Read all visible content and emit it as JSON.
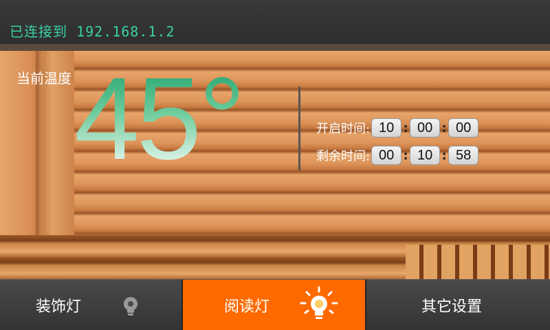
{
  "status": {
    "connection_text": "已连接到 192.168.1.2"
  },
  "temperature": {
    "label": "当前温度",
    "value": "45°"
  },
  "timers": {
    "start": {
      "label": "开启时间:",
      "hours": "10",
      "minutes": "00",
      "seconds": "00"
    },
    "remaining": {
      "label": "剩余时间:",
      "hours": "00",
      "minutes": "10",
      "seconds": "58"
    },
    "separator": ":"
  },
  "nav": {
    "items": [
      {
        "label": "装饰灯",
        "icon": "bulb-icon",
        "active": false
      },
      {
        "label": "阅读灯",
        "icon": "bulb-glow-icon",
        "active": true
      },
      {
        "label": "其它设置",
        "active": false
      }
    ]
  },
  "colors": {
    "accent": "#ff6a00",
    "status_text": "#3ad0a6",
    "temperature_gradient_top": "#1aa06a"
  }
}
